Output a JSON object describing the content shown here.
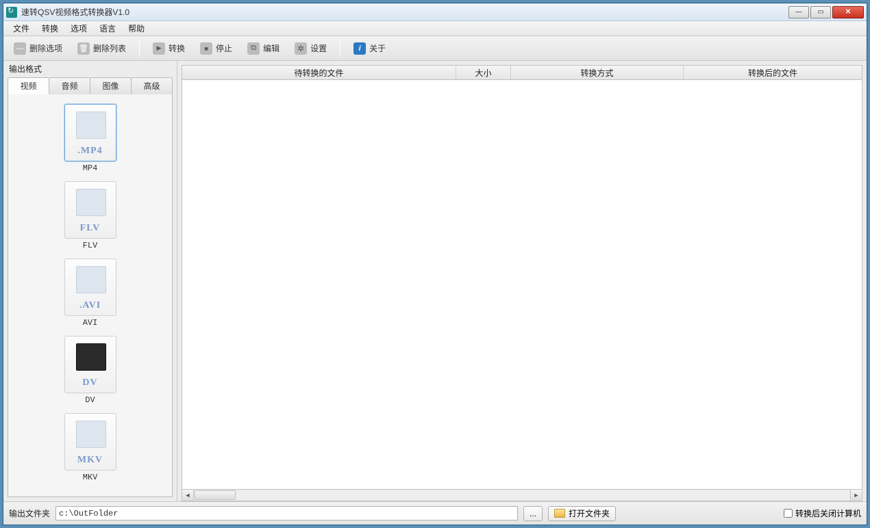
{
  "titlebar": {
    "title": "速转QSV视频格式转换器V1.0"
  },
  "menu": {
    "file": "文件",
    "convert": "转换",
    "options": "选项",
    "language": "语言",
    "help": "帮助"
  },
  "toolbar": {
    "delete_sel": "删除选项",
    "delete_list": "删除列表",
    "convert": "转换",
    "stop": "停止",
    "edit": "编辑",
    "settings": "设置",
    "about": "关于"
  },
  "left": {
    "group_title": "输出格式",
    "tabs": {
      "video": "视频",
      "audio": "音频",
      "image": "图像",
      "advanced": "高级"
    },
    "formats": [
      {
        "ext": ".MP4",
        "label": "MP4",
        "selected": true,
        "dark": false
      },
      {
        "ext": "FLV",
        "label": "FLV",
        "selected": false,
        "dark": false
      },
      {
        "ext": ".AVI",
        "label": "AVI",
        "selected": false,
        "dark": false
      },
      {
        "ext": "DV",
        "label": "DV",
        "selected": false,
        "dark": true
      },
      {
        "ext": "MKV",
        "label": "MKV",
        "selected": false,
        "dark": false
      }
    ]
  },
  "list": {
    "col_file": "待转换的文件",
    "col_size": "大小",
    "col_method": "转换方式",
    "col_output": "转换后的文件"
  },
  "bottom": {
    "out_label": "输出文件夹",
    "out_path": "c:\\OutFolder",
    "browse": "...",
    "open_folder": "打开文件夹",
    "shutdown": "转换后关闭计算机"
  }
}
